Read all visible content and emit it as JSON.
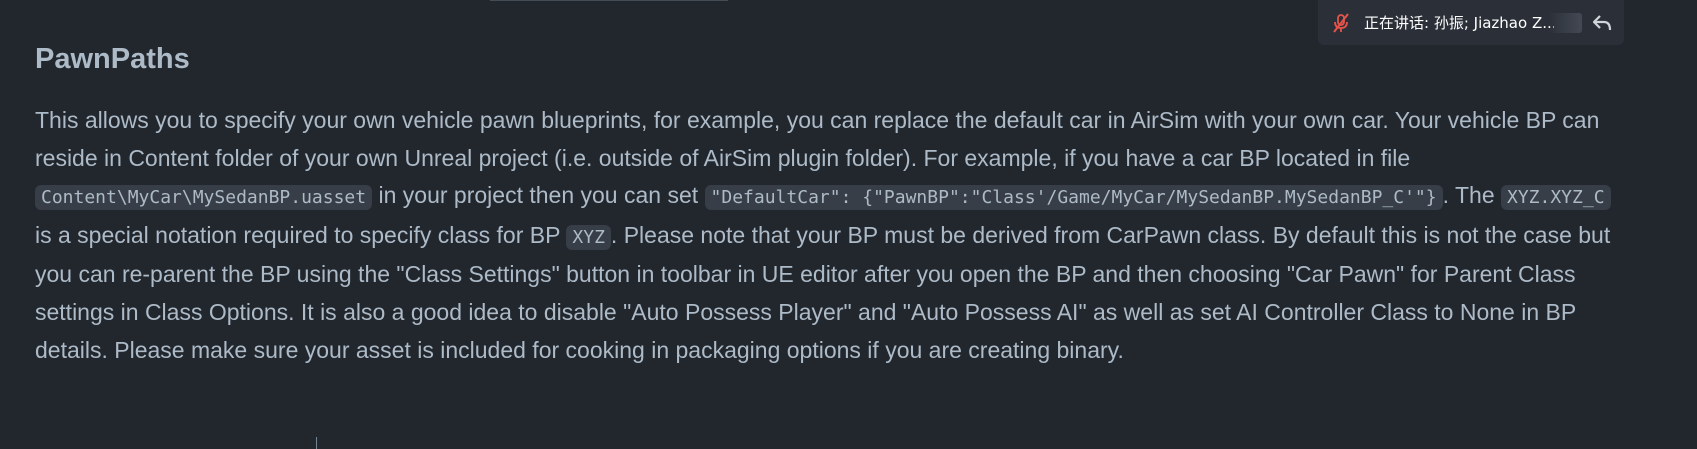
{
  "meeting": {
    "speaking_text": "正在讲话: 孙振; Jiazhao Z...",
    "mic_icon": "mic-muted-icon",
    "reply_icon": "reply-arrow-icon"
  },
  "section": {
    "title": "PawnPaths"
  },
  "paragraph": {
    "t1": "This allows you to specify your own vehicle pawn blueprints, for example, you can replace the default car in AirSim with your own car. Your vehicle BP can reside in Content folder of your own Unreal project (i.e. outside of AirSim plugin folder). For example, if you have a car BP located in file ",
    "c1": "Content\\MyCar\\MySedanBP.uasset",
    "t2": " in your project then you can set ",
    "c2": "\"DefaultCar\": {\"PawnBP\":\"Class'/Game/MyCar/MySedanBP.MySedanBP_C'\"}",
    "t3": ". The ",
    "c3": "XYZ.XYZ_C",
    "t4": " is a special notation required to specify class for BP ",
    "c4": "XYZ",
    "t5": ". Please note that your BP must be derived from CarPawn class. By default this is not the case but you can re-parent the BP using the \"Class Settings\" button in toolbar in UE editor after you open the BP and then choosing \"Car Pawn\" for Parent Class settings in Class Options. It is also a good idea to disable \"Auto Possess Player\" and \"Auto Possess AI\" as well as set AI Controller Class to None in BP details. Please make sure your asset is included for cooking in packaging options if you are creating binary."
  },
  "colors": {
    "background": "#22272e",
    "text": "#adbac7",
    "code_background": "#373e47",
    "meeting_bar": "#2b3038",
    "mic_muted": "#e5534b"
  }
}
